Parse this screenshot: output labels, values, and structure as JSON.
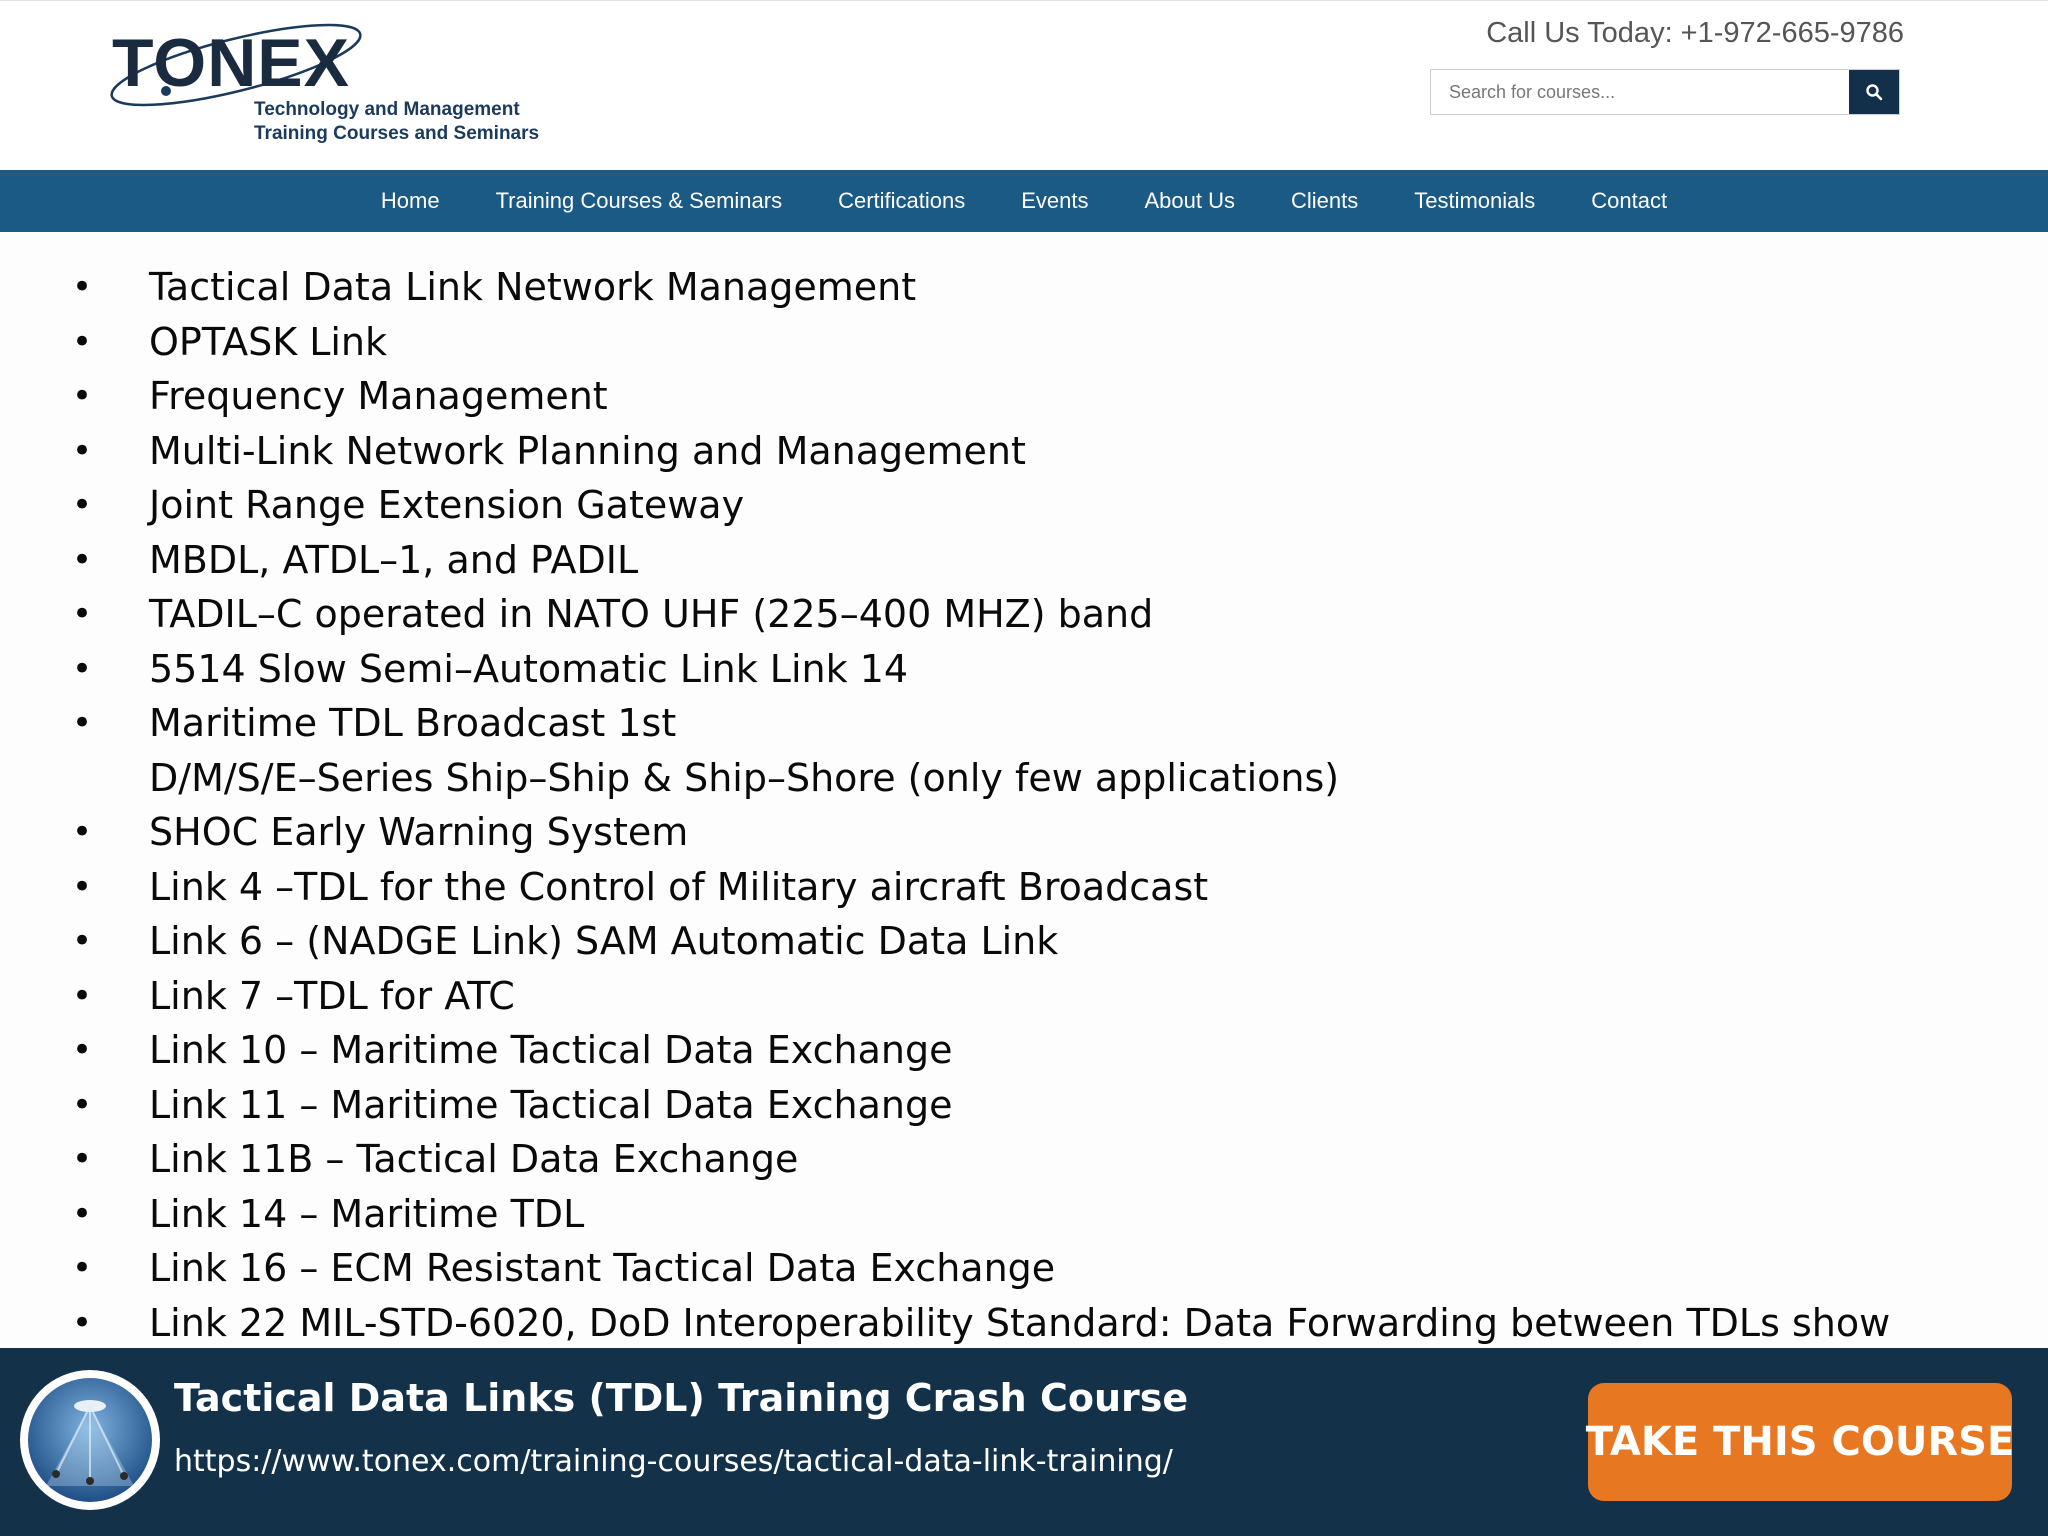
{
  "header": {
    "logo": {
      "wordmark": "TONEX",
      "tagline_line1": "Technology and Management",
      "tagline_line2": "Training Courses and Seminars"
    },
    "phone_text": "Call Us Today: +1-972-665-9786",
    "search": {
      "placeholder": "Search for courses...",
      "value": "",
      "button_icon": "search-icon"
    }
  },
  "nav": {
    "items": [
      {
        "label": "Home"
      },
      {
        "label": "Training Courses & Seminars"
      },
      {
        "label": "Certifications"
      },
      {
        "label": "Events"
      },
      {
        "label": "About Us"
      },
      {
        "label": "Clients"
      },
      {
        "label": "Testimonials"
      },
      {
        "label": "Contact"
      }
    ]
  },
  "content": {
    "bullets": [
      {
        "text": "Tactical Data Link Network Management"
      },
      {
        "text": "OPTASK Link"
      },
      {
        "text": "Frequency Management"
      },
      {
        "text": "Multi-Link Network Planning and Management"
      },
      {
        "text": "Joint Range Extension Gateway"
      },
      {
        "text": "MBDL, ATDL–1, and PADIL"
      },
      {
        "text": "TADIL–C operated in NATO UHF (225–400 MHZ) band"
      },
      {
        "text": "5514 Slow Semi–Automatic Link Link 14"
      },
      {
        "text": "Maritime TDL Broadcast 1st",
        "continuation": "D/M/S/E–Series Ship–Ship & Ship–Shore (only few applications)"
      },
      {
        "text": "SHOC Early Warning System"
      },
      {
        "text": "Link 4 –TDL for the Control of Military aircraft Broadcast"
      },
      {
        "text": "Link 6 – (NADGE Link) SAM Automatic Data Link"
      },
      {
        "text": "Link 7 –TDL for ATC"
      },
      {
        "text": "Link 10 – Maritime Tactical Data Exchange"
      },
      {
        "text": "Link 11 – Maritime Tactical Data Exchange"
      },
      {
        "text": "Link 11B – Tactical Data Exchange"
      },
      {
        "text": "Link 14 – Maritime TDL"
      },
      {
        "text": "Link 16 – ECM Resistant Tactical Data Exchange"
      },
      {
        "text": "Link 22 MIL-STD-6020, DoD Interoperability Standard: Data Forwarding between TDLs show"
      }
    ]
  },
  "footer": {
    "course_image_icon": "course-thumbnail",
    "course_title": "Tactical Data Links (TDL) Training Crash Course",
    "course_url": "https://www.tonex.com/training-courses/tactical-data-link-training/",
    "cta_label": "TAKE THIS COURSE"
  },
  "colors": {
    "nav_bg": "#1a5a85",
    "footer_bg": "#133249",
    "cta_bg": "#e87722",
    "search_button_bg": "#12304a",
    "logo_text": "#1b2b3f"
  }
}
